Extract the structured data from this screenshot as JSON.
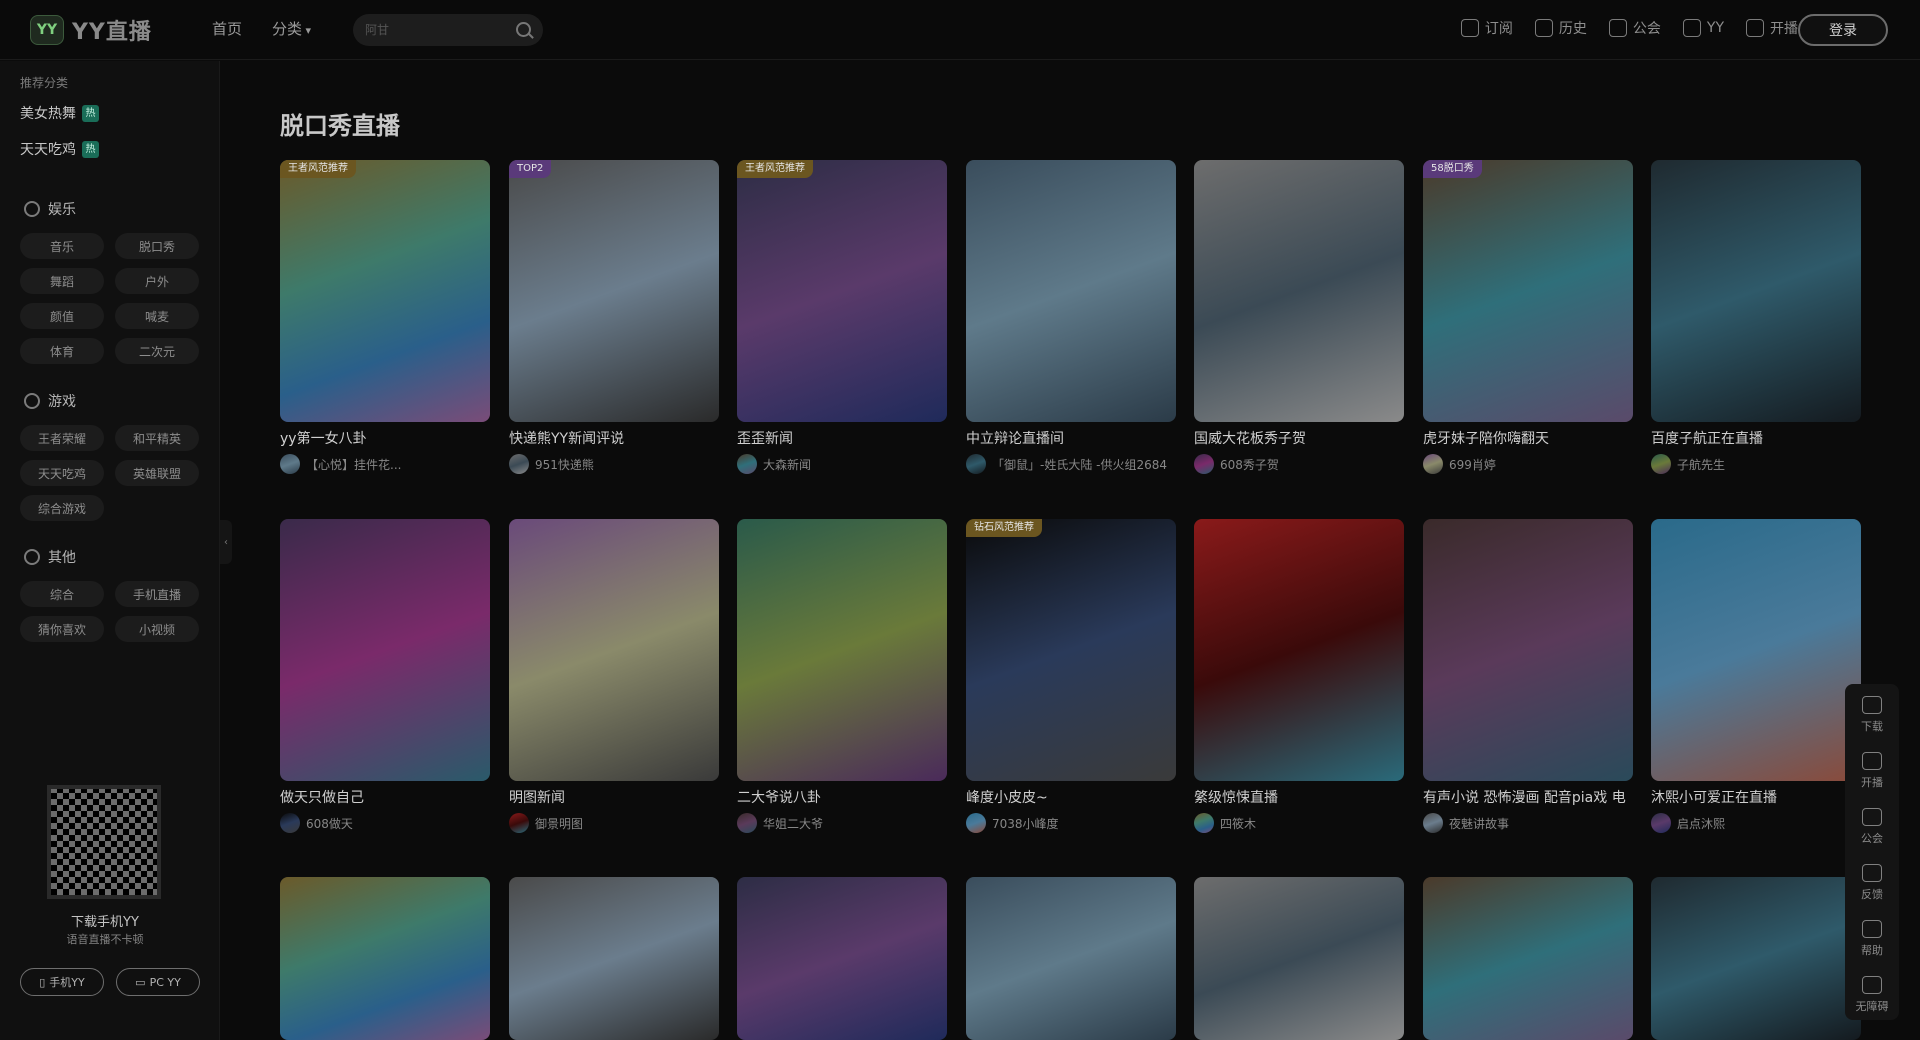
{
  "header": {
    "logo_mark": "YY",
    "logo_text": "YY直播",
    "nav": [
      "首页",
      "分类"
    ],
    "search_placeholder": "阿甘",
    "actions": [
      "订阅",
      "历史",
      "公会",
      "YY",
      "开播"
    ],
    "login": "登录"
  },
  "sidebar": {
    "recommend_label": "推荐分类",
    "recommend": [
      {
        "label": "美女热舞",
        "badge": "热"
      },
      {
        "label": "天天吃鸡",
        "badge": "热"
      }
    ],
    "groups": [
      {
        "title": "娱乐",
        "items": [
          "音乐",
          "脱口秀",
          "舞蹈",
          "户外",
          "颜值",
          "喊麦",
          "体育",
          "二次元"
        ]
      },
      {
        "title": "游戏",
        "items": [
          "王者荣耀",
          "和平精英",
          "天天吃鸡",
          "英雄联盟",
          "综合游戏"
        ]
      },
      {
        "title": "其他",
        "items": [
          "综合",
          "手机直播",
          "猜你喜欢",
          "小视频"
        ]
      }
    ],
    "qr_title": "下载手机YY",
    "qr_sub": "语音直播不卡顿",
    "buttons": [
      "手机YY",
      "PC YY"
    ]
  },
  "main": {
    "title": "脱口秀直播",
    "cards": [
      {
        "title": "yy第一女八卦",
        "streamer": "【心悦】挂件花...",
        "badge": "王者风范推荐"
      },
      {
        "title": "快递熊YY新闻评说",
        "streamer": "951快递熊",
        "badge": "TOP2"
      },
      {
        "title": "歪歪新闻",
        "streamer": "大森新闻",
        "badge": "王者风范推荐"
      },
      {
        "title": "中立辩论直播间",
        "streamer": "「御鼠」-姓氏大陆 -供火组2684",
        "badge": ""
      },
      {
        "title": "国威大花板秀子贺",
        "streamer": "608秀子贺",
        "badge": ""
      },
      {
        "title": "虎牙妹子陪你嗨翻天",
        "streamer": "699肖婷",
        "badge": "58脱口秀"
      },
      {
        "title": "百度子航正在直播",
        "streamer": "子航先生",
        "badge": ""
      },
      {
        "title": "做天只做自己",
        "streamer": "608做天",
        "badge": ""
      },
      {
        "title": "明图新闻",
        "streamer": "御景明图",
        "badge": ""
      },
      {
        "title": "二大爷说八卦",
        "streamer": "华姐二大爷",
        "badge": ""
      },
      {
        "title": "峰度小皮皮~",
        "streamer": "7038小峰度",
        "badge": "钻石风范推荐"
      },
      {
        "title": "綮级惊悚直播",
        "streamer": "四筱木",
        "badge": ""
      },
      {
        "title": "有声小说 恐怖漫画 配音pia戏 电",
        "streamer": "夜魅讲故事",
        "badge": ""
      },
      {
        "title": "沐熙小可爱正在直播",
        "streamer": "启点沐熙",
        "badge": ""
      },
      {
        "title": "",
        "streamer": "",
        "badge": ""
      },
      {
        "title": "",
        "streamer": "",
        "badge": ""
      },
      {
        "title": "",
        "streamer": "",
        "badge": ""
      },
      {
        "title": "",
        "streamer": "",
        "badge": ""
      },
      {
        "title": "",
        "streamer": "",
        "badge": ""
      },
      {
        "title": "",
        "streamer": "",
        "badge": ""
      },
      {
        "title": "",
        "streamer": "",
        "badge": ""
      }
    ]
  },
  "float_bar": [
    "下载",
    "开播",
    "公会",
    "反馈",
    "帮助",
    "无障碍"
  ]
}
